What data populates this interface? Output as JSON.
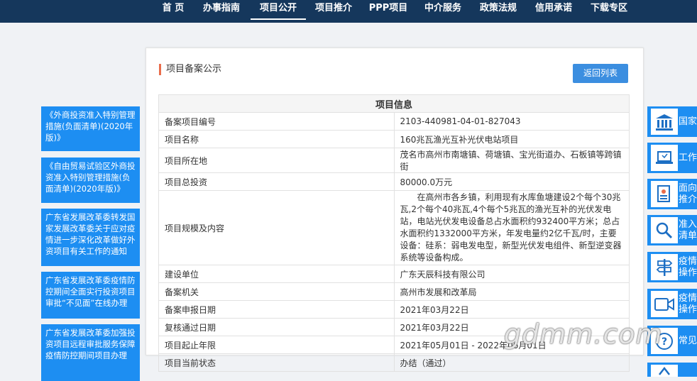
{
  "nav": {
    "items": [
      "首 页",
      "办事指南",
      "项目公开",
      "项目推介",
      "PPP项目",
      "中介服务",
      "政策法规",
      "信用承诺",
      "下载专区"
    ],
    "active_index": 2
  },
  "left_links": [
    "《外商投资准入特别管理措施(负面清单)(2020年版)》",
    "《自由贸易试验区外商投资准入特别管理措施(负面清单)(2020年版)》",
    "广东省发展改革委转发国家发展改革委关于应对疫情进一步深化改革做好外资项目有关工作的通知",
    "广东省发展改革委疫情防控期间全面实行投资项目审批“不见面”在线办理",
    "广东省发展改革委加强投资项目远程审批服务保障疫情防控期间项目办理"
  ],
  "panel": {
    "title": "项目备案公示",
    "back_label": "返回列表",
    "table_header": "项目信息",
    "rows": [
      {
        "label": "备案项目编号",
        "value": "2103-440981-04-01-827043"
      },
      {
        "label": "项目名称",
        "value": "160兆瓦渔光互补光伏电站项目"
      },
      {
        "label": "项目所在地",
        "value": "茂名市高州市南塘镇、荷塘镇、宝光街道办、石板镇等跨镇街"
      },
      {
        "label": "项目总投资",
        "value": "80000.0万元"
      },
      {
        "label": "项目规模及内容",
        "value": "　　在高州市各乡镇，利用现有水库鱼塘建设2个每个30兆瓦,2个每个40兆瓦,4个每个5兆瓦的渔光互补的光伏发电站，电站光伏发电设备总占水面积约932400平方米；总占水面积约1332000平方米，年发电量约2亿千瓦/时，主要设备：硅系：弱电发电型，新型光伏发电组件、新型逆变器系统等设备构成。"
      },
      {
        "label": "建设单位",
        "value": "广东天辰科技有限公司"
      },
      {
        "label": "备案机关",
        "value": "高州市发展和改革局"
      },
      {
        "label": "备案申报日期",
        "value": "2021年03月22日"
      },
      {
        "label": "复核通过日期",
        "value": "2021年03月22日"
      },
      {
        "label": "项目起止年限",
        "value": "2021年05月01日 - 2022年06月01日"
      },
      {
        "label": "项目当前状态",
        "value": "办结（通过）"
      }
    ]
  },
  "right_links": [
    {
      "label": "国家",
      "icon": "bank-icon"
    },
    {
      "label": "工作",
      "icon": "laptop-icon"
    },
    {
      "label": "面向民间\n推介",
      "icon": "document-user-icon"
    },
    {
      "label": "准入\n清单",
      "icon": "search-icon"
    },
    {
      "label": "疫情防\n操作",
      "icon": "signpost-icon"
    },
    {
      "label": "疫情防\n操作指",
      "icon": "video-camera-icon"
    },
    {
      "label": "常见",
      "icon": "question-icon"
    },
    {
      "label": "",
      "icon": "tools-icon"
    }
  ],
  "watermark": "gdmm.com",
  "colors": {
    "topbar": "#15375c",
    "accent_blue": "#1d8ef2",
    "button_blue": "#3b8ee0",
    "title_marker": "#e96d4c"
  }
}
